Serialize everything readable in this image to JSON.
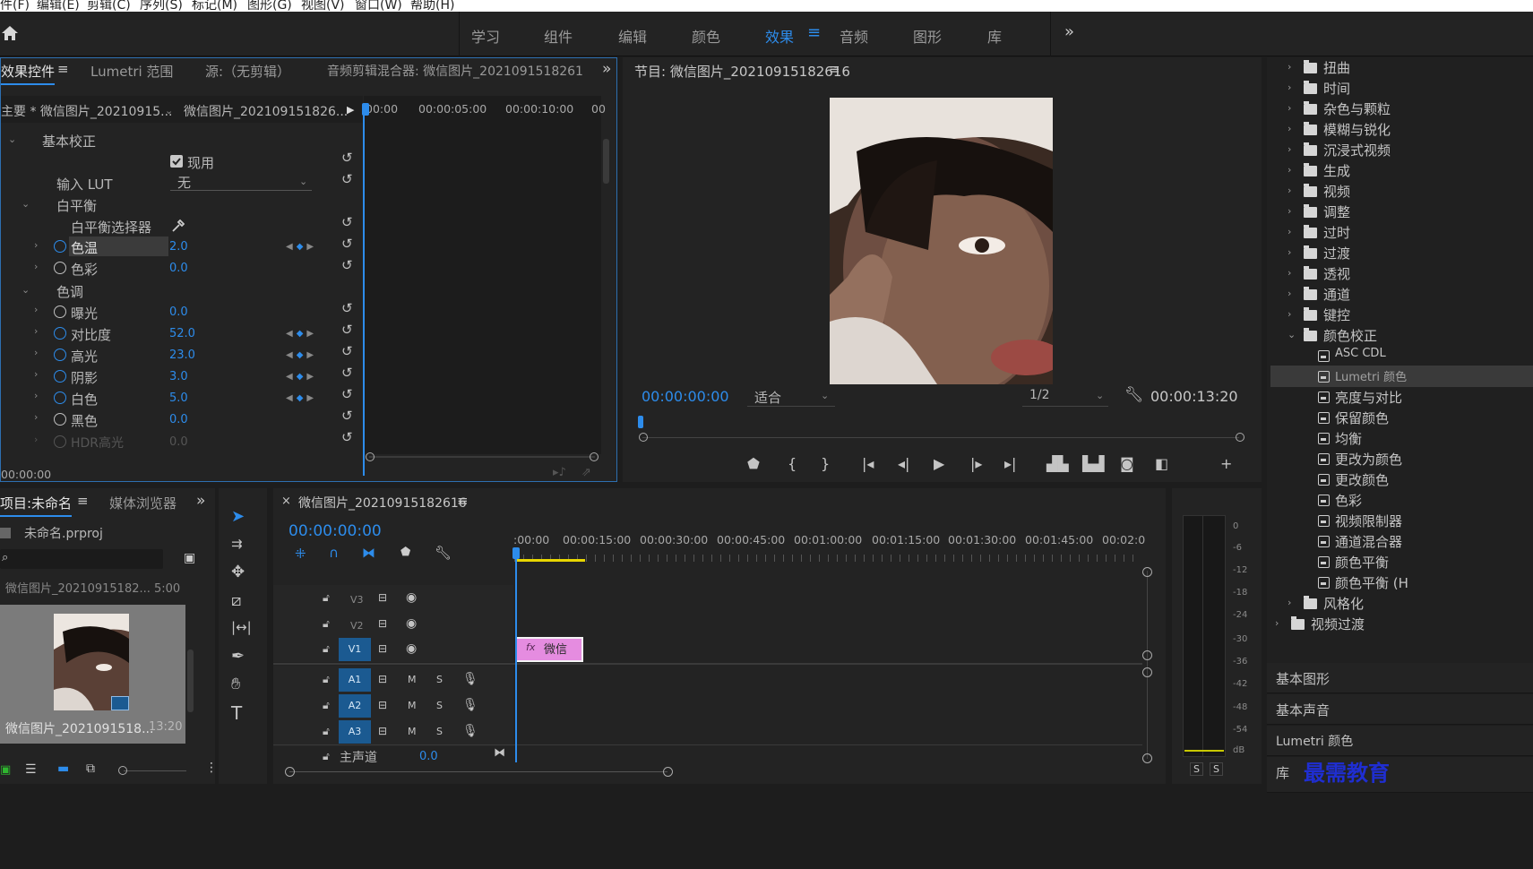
{
  "menubar": [
    "件(F)",
    "编辑(E)",
    "剪辑(C)",
    "序列(S)",
    "标记(M)",
    "图形(G)",
    "视图(V)",
    "窗口(W)",
    "帮助(H)"
  ],
  "workspaces": [
    "学习",
    "组件",
    "编辑",
    "颜色",
    "效果",
    "音频",
    "图形",
    "库"
  ],
  "active_workspace": "效果",
  "effect_controls": {
    "tabs": [
      "效果控件",
      "Lumetri 范围",
      "源:（无剪辑）",
      "音频剪辑混合器: 微信图片_2021091518261"
    ],
    "source_label": "主要 * 微信图片_20210915...",
    "clip_label": "微信图片_202109151826...",
    "ruler": [
      "00:00",
      "00:00:05:00",
      "00:00:10:00",
      "00"
    ],
    "section": "基本校正",
    "enable_label": "现用",
    "lut_label": "输入 LUT",
    "lut_value": "无",
    "white_balance": "白平衡",
    "wb_selector": "白平衡选择器",
    "color_temp": {
      "label": "色温",
      "value": "2.0"
    },
    "tint": {
      "label": "色彩",
      "value": "0.0"
    },
    "tone": "色调",
    "exposure": {
      "label": "曝光",
      "value": "0.0"
    },
    "contrast": {
      "label": "对比度",
      "value": "52.0"
    },
    "highlights": {
      "label": "高光",
      "value": "23.0"
    },
    "shadows": {
      "label": "阴影",
      "value": "3.0"
    },
    "whites": {
      "label": "白色",
      "value": "5.0"
    },
    "blacks": {
      "label": "黑色",
      "value": "0.0"
    },
    "hdr": {
      "label": "HDR高光",
      "value": "0.0"
    },
    "timecode": "00:00:00"
  },
  "program": {
    "title": "节目: 微信图片_20210915182616",
    "timecode": "00:00:00:00",
    "fit": "适合",
    "resolution": "1/2",
    "duration": "00:00:13:20"
  },
  "effects_panel": {
    "folders": [
      "扭曲",
      "时间",
      "杂色与颗粒",
      "模糊与锐化",
      "沉浸式视频",
      "生成",
      "视频",
      "调整",
      "过时",
      "过渡",
      "透视",
      "通道",
      "键控",
      "颜色校正"
    ],
    "presets": [
      "ASC CDL",
      "Lumetri 颜色",
      "亮度与对比",
      "保留颜色",
      "均衡",
      "更改为颜色",
      "更改颜色",
      "色彩",
      "视频限制器",
      "通道混合器",
      "颜色平衡",
      "颜色平衡 (H"
    ],
    "after": [
      "风格化"
    ],
    "video_transitions": "视频过渡",
    "tabs": [
      "基本图形",
      "基本声音",
      "Lumetri 颜色",
      "库"
    ]
  },
  "project": {
    "title": "项目:未命名",
    "browser": "媒体浏览器",
    "file": "未命名.prproj",
    "list_item": "微信图片_20210915182...   5:00",
    "thumb_name": "微信图片_2021091518...",
    "thumb_dur": "13:20"
  },
  "timeline": {
    "title": "微信图片_20210915182616",
    "timecode": "00:00:00:00",
    "ruler": [
      ":00:00",
      "00:00:15:00",
      "00:00:30:00",
      "00:00:45:00",
      "00:01:00:00",
      "00:01:15:00",
      "00:01:30:00",
      "00:01:45:00",
      "00:02:0"
    ],
    "video_tracks": [
      "V3",
      "V2",
      "V1"
    ],
    "audio_tracks": [
      "A1",
      "A2",
      "A3"
    ],
    "master": "主声道",
    "master_value": "0.0",
    "clip_label": "微信",
    "fx": "fx"
  },
  "meter": {
    "labels": [
      "0",
      "-6",
      "-12",
      "-18",
      "-24",
      "-30",
      "-36",
      "-42",
      "-48",
      "-54",
      "dB"
    ],
    "solo": "S"
  },
  "watermark": "最需教育"
}
